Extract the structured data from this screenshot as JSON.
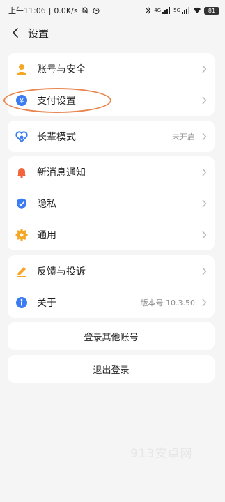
{
  "status_bar": {
    "time": "上午11:06",
    "speed": "0.0K/s",
    "net1": "4G",
    "net2": "5G",
    "battery": "81"
  },
  "header": {
    "title": "设置"
  },
  "groups": [
    {
      "items": [
        {
          "label": "账号与安全",
          "icon": "person-icon",
          "color": "#f5a623"
        },
        {
          "label": "支付设置",
          "icon": "yuan-icon",
          "color": "#3b7cf2"
        }
      ]
    },
    {
      "items": [
        {
          "label": "长辈模式",
          "value": "未开启",
          "icon": "heart-icon",
          "color": "#3b7cf2"
        }
      ]
    },
    {
      "items": [
        {
          "label": "新消息通知",
          "icon": "bell-icon",
          "color": "#f2643a"
        },
        {
          "label": "隐私",
          "icon": "shield-icon",
          "color": "#3b7cf2"
        },
        {
          "label": "通用",
          "icon": "gear-icon",
          "color": "#f5a623"
        }
      ]
    },
    {
      "items": [
        {
          "label": "反馈与投诉",
          "icon": "pen-icon",
          "color": "#f5a623"
        },
        {
          "label": "关于",
          "value": "版本号 10.3.50",
          "icon": "info-icon",
          "color": "#3b7cf2"
        }
      ]
    }
  ],
  "actions": {
    "switch_account": "登录其他账号",
    "logout": "退出登录"
  },
  "watermark": "913安卓网",
  "colors": {
    "background": "#f5f5f5",
    "card": "#ffffff",
    "highlight": "#e8864f"
  }
}
